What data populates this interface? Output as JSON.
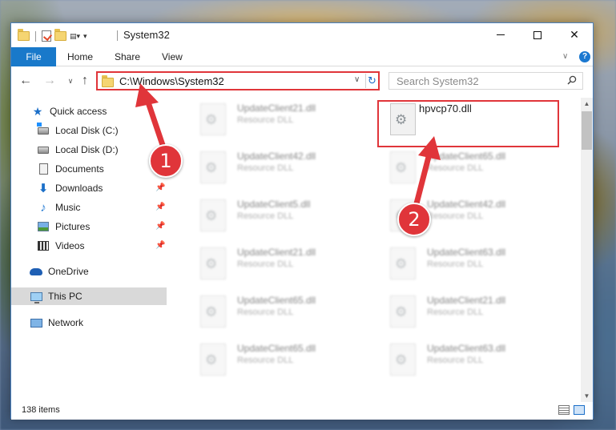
{
  "window": {
    "title": "System32",
    "minimize_glyph": "",
    "close_glyph": "✕"
  },
  "ribbon": {
    "tabs": [
      {
        "label": "File"
      },
      {
        "label": "Home"
      },
      {
        "label": "Share"
      },
      {
        "label": "View"
      }
    ],
    "help_label": "?"
  },
  "navigation": {
    "back_glyph": "←",
    "forward_glyph": "→",
    "recent_glyph": "∨",
    "up_glyph": "↑",
    "address": "C:\\Windows\\System32",
    "address_dropdown_glyph": "∨",
    "refresh_glyph": "↻",
    "search_placeholder": "Search System32"
  },
  "sidebar": {
    "items": [
      {
        "label": "Quick access",
        "icon": "star-icon",
        "pinned": false
      },
      {
        "label": "Local Disk (C:)",
        "icon": "drive-icon",
        "pinned": false
      },
      {
        "label": "Local Disk (D:)",
        "icon": "drive-icon",
        "pinned": false
      },
      {
        "label": "Documents",
        "icon": "documents-icon",
        "pinned": true
      },
      {
        "label": "Downloads",
        "icon": "download-icon",
        "pinned": true
      },
      {
        "label": "Music",
        "icon": "music-icon",
        "pinned": true
      },
      {
        "label": "Pictures",
        "icon": "pictures-icon",
        "pinned": true
      },
      {
        "label": "Videos",
        "icon": "videos-icon",
        "pinned": true
      },
      {
        "label": "OneDrive",
        "icon": "cloud-icon",
        "pinned": false
      },
      {
        "label": "This PC",
        "icon": "computer-icon",
        "pinned": false,
        "selected": true
      },
      {
        "label": "Network",
        "icon": "network-icon",
        "pinned": false
      }
    ]
  },
  "files": [
    {
      "name": "UpdateClient21.dll",
      "type": "Resource DLL"
    },
    {
      "name": "hpvcp70.dll",
      "type": ""
    },
    {
      "name": "UpdateClient42.dll",
      "type": "Resource DLL"
    },
    {
      "name": "UpdateClient65.dll",
      "type": "Resource DLL"
    },
    {
      "name": "UpdateClient5.dll",
      "type": "Resource DLL"
    },
    {
      "name": "UpdateClient42.dll",
      "type": "Resource DLL"
    },
    {
      "name": "UpdateClient21.dll",
      "type": "Resource DLL"
    },
    {
      "name": "UpdateClient63.dll",
      "type": "Resource DLL"
    },
    {
      "name": "UpdateClient65.dll",
      "type": "Resource DLL"
    },
    {
      "name": "UpdateClient21.dll",
      "type": "Resource DLL"
    },
    {
      "name": "UpdateClient65.dll",
      "type": "Resource DLL"
    },
    {
      "name": "UpdateClient63.dll",
      "type": "Resource DLL"
    }
  ],
  "status": {
    "item_count": "138 items"
  },
  "callouts": [
    {
      "label": "1"
    },
    {
      "label": "2"
    }
  ],
  "colors": {
    "accent": "#1979ca",
    "callout_red": "#e0353a"
  }
}
